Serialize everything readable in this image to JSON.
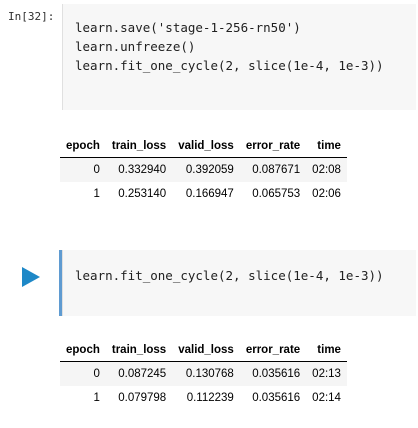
{
  "cell1": {
    "prompt": "In[32]:",
    "code": [
      "learn.save('stage-1-256-rn50')",
      "learn.unfreeze()",
      "learn.fit_one_cycle(2, slice(1e-4, 1e-3))"
    ]
  },
  "output1": {
    "headers": [
      "epoch",
      "train_loss",
      "valid_loss",
      "error_rate",
      "time"
    ],
    "rows": [
      [
        "0",
        "0.332940",
        "0.392059",
        "0.087671",
        "02:08"
      ],
      [
        "1",
        "0.253140",
        "0.166947",
        "0.065753",
        "02:06"
      ]
    ]
  },
  "cell2": {
    "code": [
      "learn.fit_one_cycle(2, slice(1e-4, 1e-3))"
    ],
    "run_icon": "play-icon",
    "run_color": "#1e88c7"
  },
  "output2": {
    "headers": [
      "epoch",
      "train_loss",
      "valid_loss",
      "error_rate",
      "time"
    ],
    "rows": [
      [
        "0",
        "0.087245",
        "0.130768",
        "0.035616",
        "02:13"
      ],
      [
        "1",
        "0.079798",
        "0.112239",
        "0.035616",
        "02:14"
      ]
    ]
  }
}
